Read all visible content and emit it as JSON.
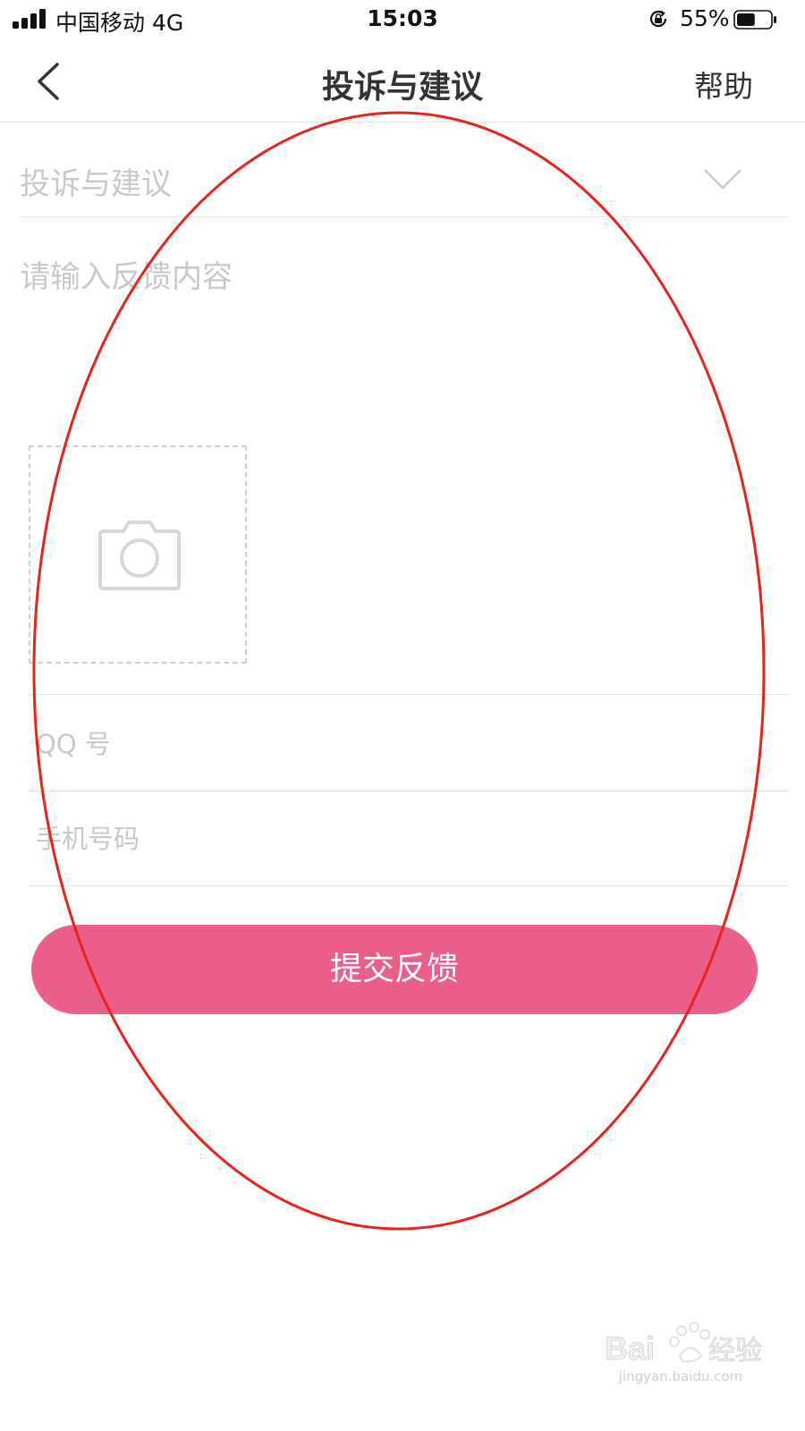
{
  "status_bar": {
    "carrier": "中国移动   4G",
    "time": "15:03",
    "battery_percent": "55%",
    "battery_level": 0.55
  },
  "nav": {
    "title": "投诉与建议",
    "help_label": "帮助"
  },
  "form": {
    "category": {
      "selected": "投诉与建议"
    },
    "feedback": {
      "placeholder": "请输入反馈内容",
      "value": ""
    },
    "qq": {
      "placeholder": "QQ 号"
    },
    "phone": {
      "placeholder": "手机号码"
    },
    "submit_label": "提交反馈"
  },
  "watermark": {
    "text": "jingyan.baidu.com"
  },
  "colors": {
    "accent": "#ec5e8a",
    "annotation": "#e8221c",
    "placeholder": "#c8c8c8"
  },
  "icons": {
    "back": "back-icon",
    "chevron": "chevron-down-icon",
    "camera": "camera-icon",
    "lock": "rotation-lock-icon",
    "battery": "battery-icon",
    "signal": "signal-icon"
  }
}
